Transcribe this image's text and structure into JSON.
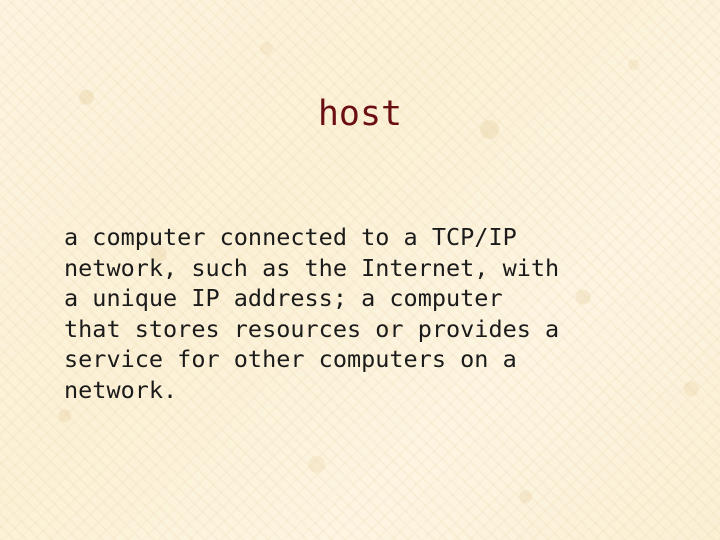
{
  "slide": {
    "title": "host",
    "body": "a computer connected to a TCP/IP\nnetwork, such as the Internet, with\na unique IP address; a computer\nthat stores resources or provides a\nservice for other computers on a\nnetwork.",
    "colors": {
      "background": "#fdf3dc",
      "title": "#6b0f14",
      "body": "#1b1b1b"
    }
  }
}
